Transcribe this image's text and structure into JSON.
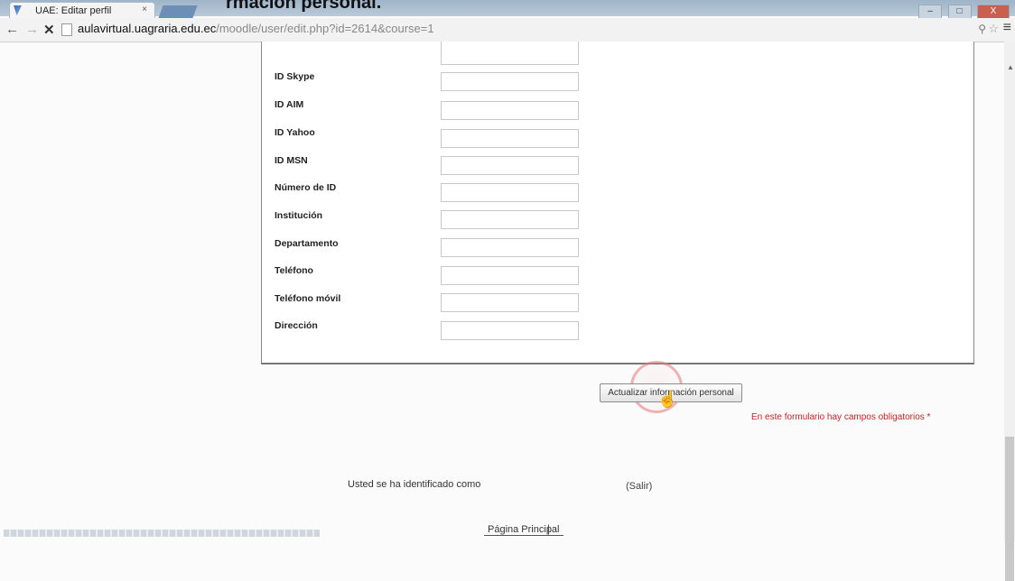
{
  "browser": {
    "header_title": "rmación personal.",
    "tab_title": "UAE: Editar perfil",
    "tab_close": "×",
    "url_host": "aulavirtual.uagraria.edu.ec",
    "url_path": "/moodle/user/edit.php?id=2614&course=1",
    "back_glyph": "←",
    "forward_glyph": "→",
    "stop_glyph": "✕",
    "menu_glyph": "≡",
    "zoom_glyph": "⚲",
    "star_glyph": "☆",
    "window_buttons": {
      "minimize": "–",
      "maximize": "□",
      "close": "X"
    }
  },
  "form": {
    "fields": [
      {
        "label": "ID Skype",
        "value": ""
      },
      {
        "label": "ID AIM",
        "value": ""
      },
      {
        "label": "ID Yahoo",
        "value": ""
      },
      {
        "label": "ID MSN",
        "value": ""
      },
      {
        "label": "Número de ID",
        "value": ""
      },
      {
        "label": "Institución",
        "value": ""
      },
      {
        "label": "Departamento",
        "value": ""
      },
      {
        "label": "Teléfono",
        "value": ""
      },
      {
        "label": "Teléfono móvil",
        "value": ""
      },
      {
        "label": "Dirección",
        "value": ""
      }
    ],
    "submit_label": "Actualizar información personal",
    "required_note": "En este formulario hay campos obligatorios",
    "required_marker": "*"
  },
  "footer": {
    "login_info": "Usted se ha identificado como",
    "logout_label": "(Salir)",
    "home_label": "Página Principal",
    "home_separator": "|"
  },
  "colors": {
    "required_red": "#cc2222",
    "panel_border": "#777777",
    "title_strip": "#9fb4c8"
  }
}
